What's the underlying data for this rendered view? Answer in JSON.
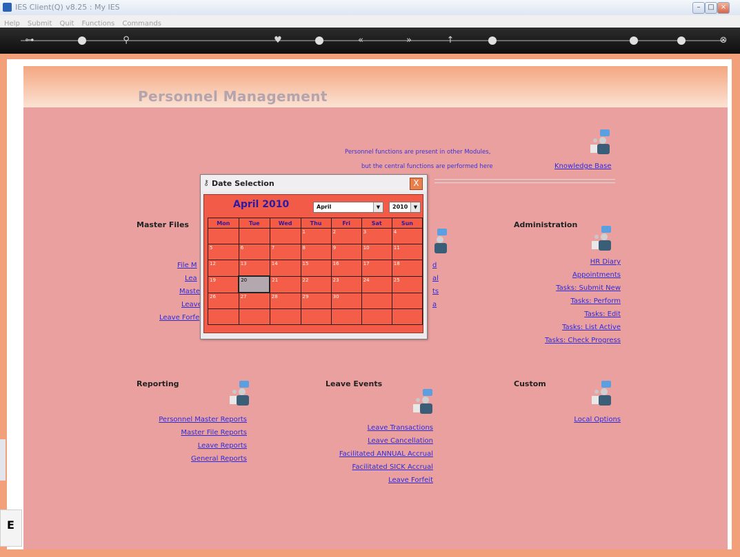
{
  "window": {
    "title": "IES Client(Q) v8.25 : My IES"
  },
  "menu": [
    "Help",
    "Submit",
    "Quit",
    "Functions",
    "Commands"
  ],
  "page": {
    "title": "Personnel Management"
  },
  "note": {
    "line1": "Personnel functions are present in other Modules,",
    "line2": "but the central functions are performed here"
  },
  "links": {
    "knowledge_base": "Knowledge Base",
    "master_partial": [
      "File M",
      "Lea",
      "Maste",
      "Leave",
      "Leave Forfe"
    ],
    "mid_partial": [
      "d",
      "al",
      "ts",
      "a"
    ]
  },
  "sections": {
    "master": {
      "title": "Master Files"
    },
    "admin": {
      "title": "Administration",
      "items": [
        "HR Diary",
        "Appointments",
        "Tasks: Submit New",
        "Tasks: Perform",
        "Tasks: Edit",
        "Tasks: List Active",
        "Tasks: Check Progress"
      ]
    },
    "reporting": {
      "title": "Reporting",
      "items": [
        "Personnel Master Reports",
        "Master File Reports",
        "Leave Reports",
        "General Reports"
      ]
    },
    "leave": {
      "title": "Leave Events",
      "items": [
        "Leave Transactions",
        "Leave Cancellation",
        "Facilitated ANNUAL Accrual",
        "Facilitated SICK Accrual",
        "Leave Forfeit"
      ]
    },
    "custom": {
      "title": "Custom",
      "items": [
        "Local Options"
      ]
    }
  },
  "dialog": {
    "title": "Date Selection",
    "close": "X",
    "month_title": "April 2010",
    "month_select": "April",
    "year_select": "2010",
    "weekdays": [
      "Mon",
      "Tue",
      "Wed",
      "Thu",
      "Fri",
      "Sat",
      "Sun"
    ],
    "weeks": [
      [
        "",
        "",
        "",
        "1",
        "2",
        "3",
        "4"
      ],
      [
        "5",
        "6",
        "7",
        "8",
        "9",
        "10",
        "11"
      ],
      [
        "12",
        "13",
        "14",
        "15",
        "16",
        "17",
        "18"
      ],
      [
        "19",
        "20",
        "21",
        "22",
        "23",
        "24",
        "25"
      ],
      [
        "26",
        "27",
        "28",
        "29",
        "30",
        "",
        ""
      ],
      [
        "",
        "",
        "",
        "",
        "",
        "",
        ""
      ]
    ],
    "selected_day": "20"
  },
  "side": {
    "letter": "E"
  },
  "colors": {
    "content_bg": "#eba0a0",
    "calendar_bg": "#f25b48",
    "link": "#2d2bd8"
  }
}
